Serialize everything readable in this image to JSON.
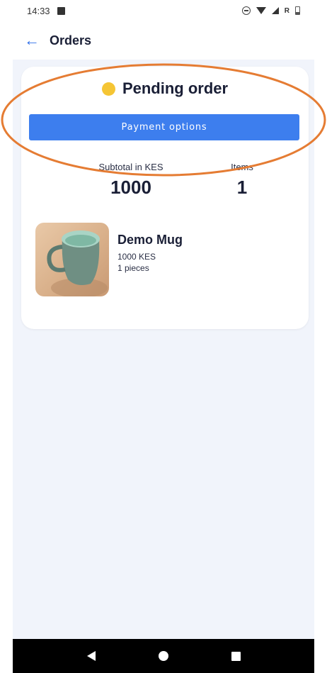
{
  "status_bar": {
    "time": "14:33",
    "icons": [
      "image-icon",
      "dnd-icon",
      "wifi-icon",
      "signal-icon",
      "battery-icon"
    ],
    "roaming_label": "R"
  },
  "header": {
    "back_icon": "arrow-left-icon",
    "title": "Orders"
  },
  "order": {
    "status_color": "#f5c534",
    "status_title": "Pending order",
    "payment_button_label": "Payment options",
    "subtotal_label": "Subtotal in KES",
    "subtotal_value": "1000",
    "items_label": "Items",
    "items_value": "1",
    "product": {
      "name": "Demo Mug",
      "price": "1000 KES",
      "quantity": "1 pieces"
    }
  },
  "nav_bar": {
    "buttons": [
      "back-icon",
      "home-icon",
      "recents-icon"
    ]
  },
  "colors": {
    "accent": "#3d7eee",
    "page_background": "#f1f4fb",
    "highlight": "#e57c33"
  }
}
